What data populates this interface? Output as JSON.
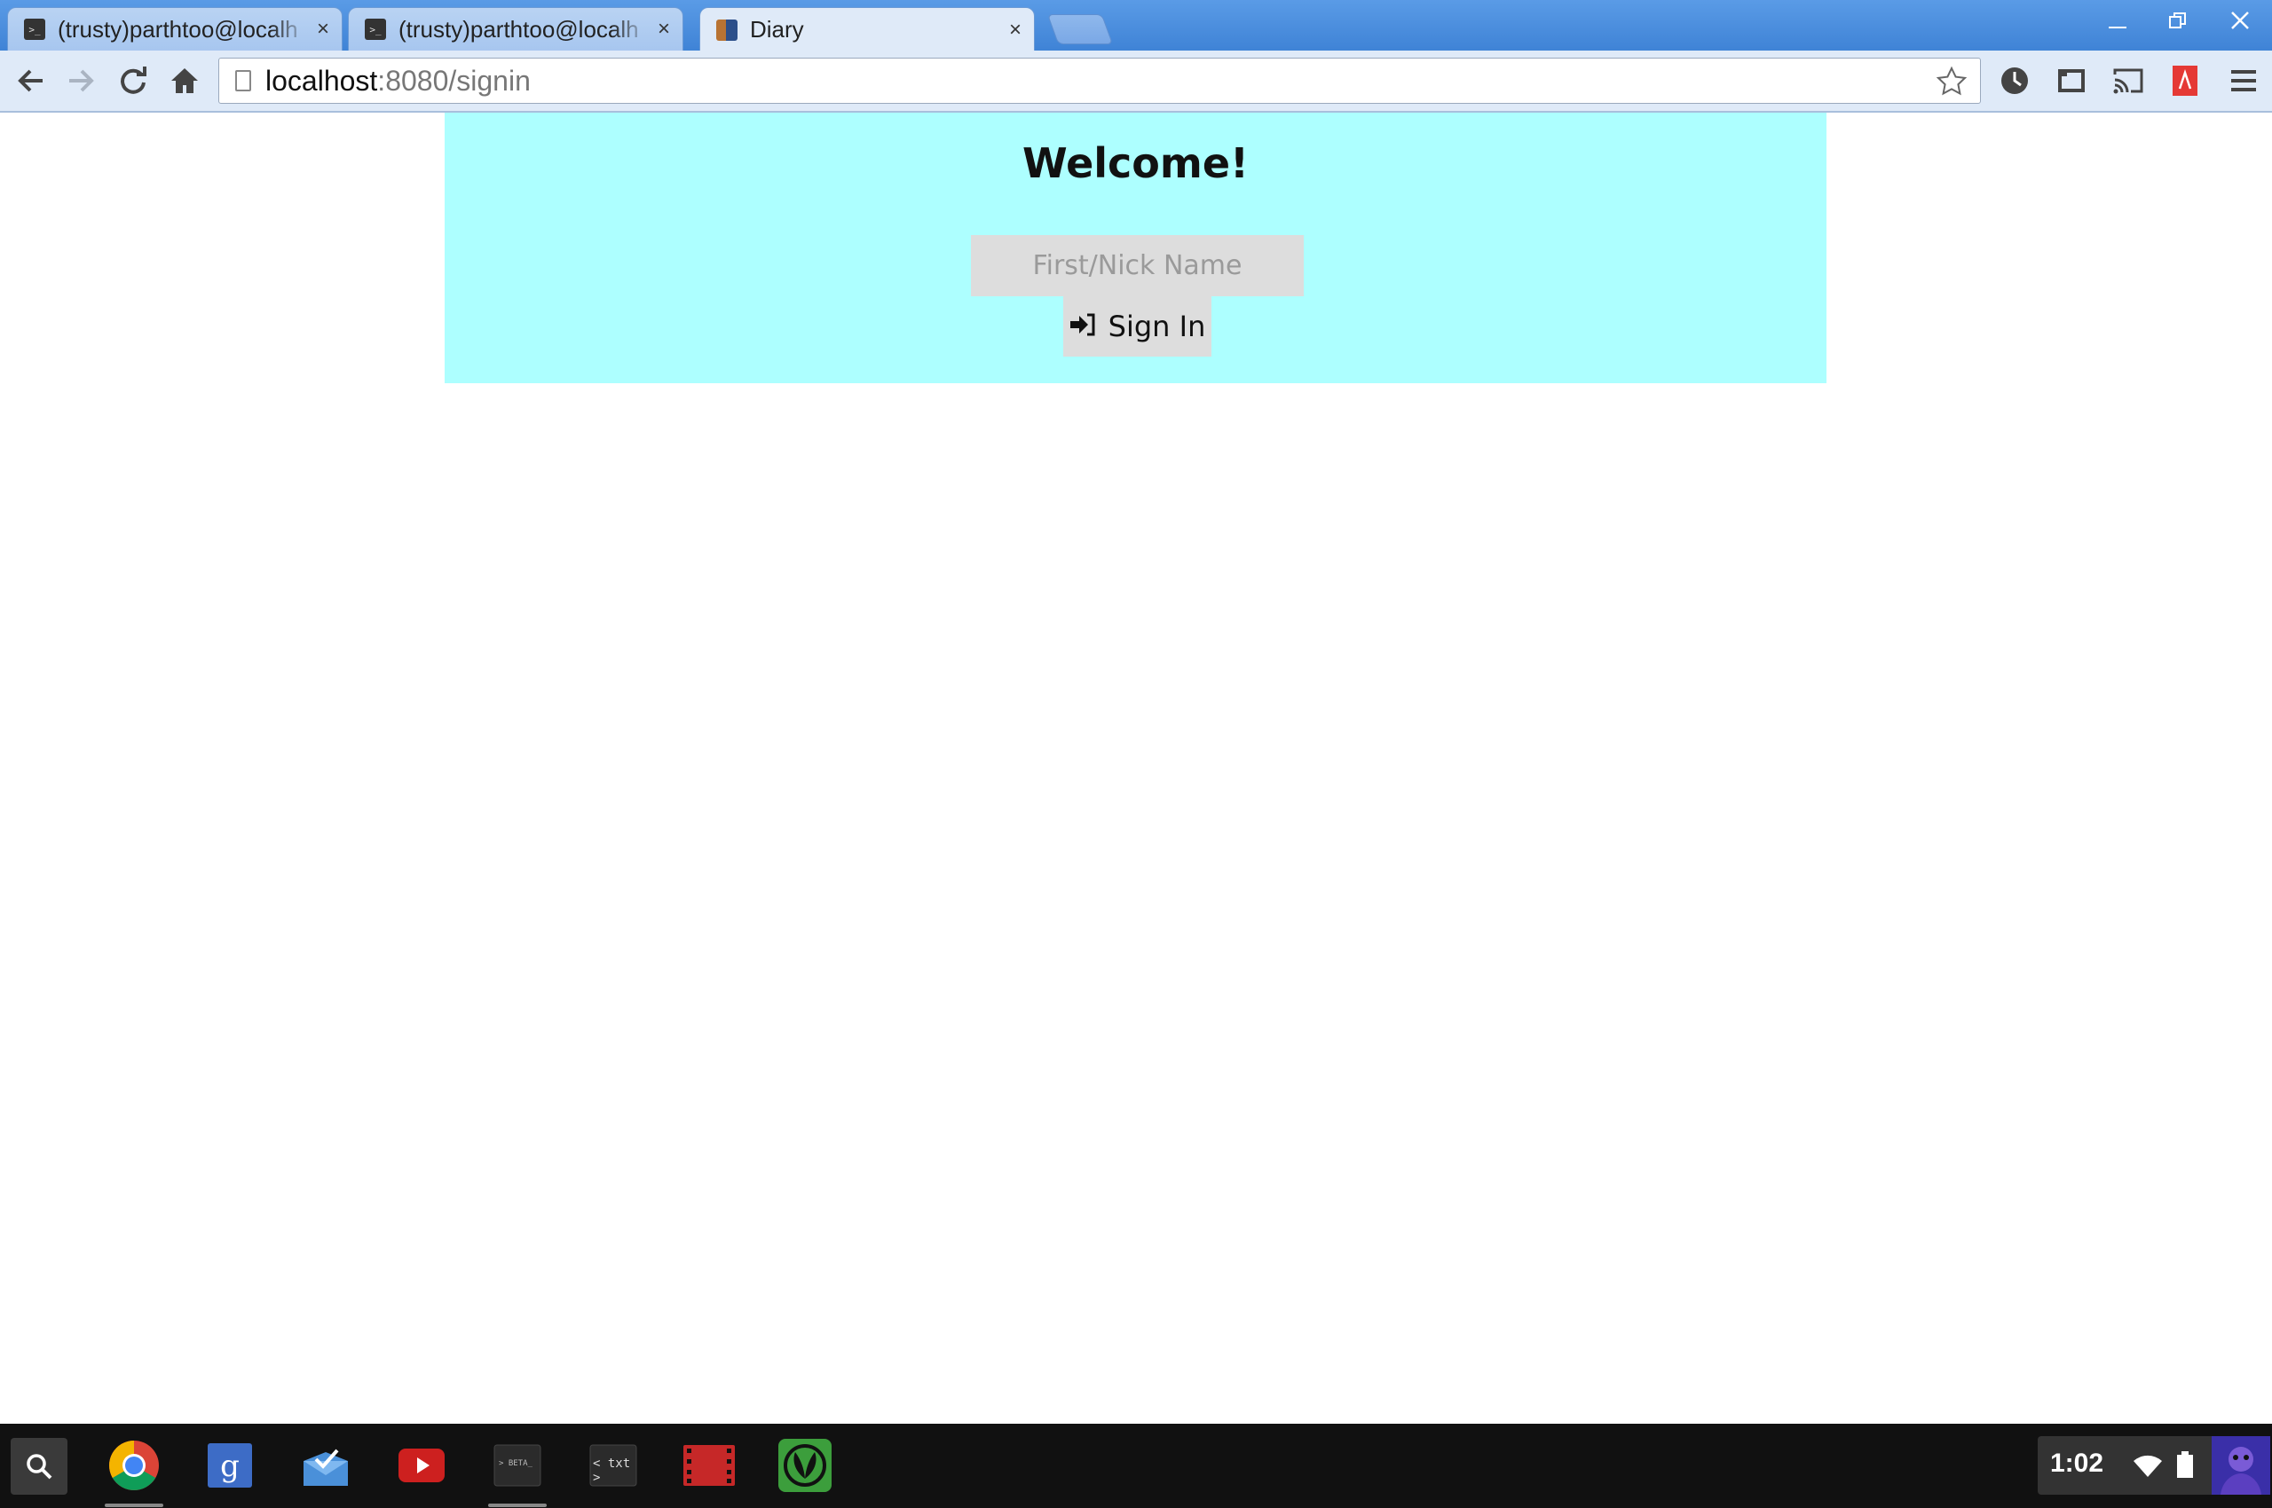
{
  "browser": {
    "tabs": [
      {
        "title": "(trusty)parthtoo@localh",
        "favicon": "terminal-icon",
        "active": false
      },
      {
        "title": "(trusty)parthtoo@localh",
        "favicon": "terminal-icon",
        "active": false
      },
      {
        "title": "Diary",
        "favicon": "diary-icon",
        "active": true
      }
    ],
    "close_glyph": "×",
    "url_host": "localhost",
    "url_path": ":8080/signin"
  },
  "page": {
    "heading": "Welcome!",
    "name_placeholder": "First/Nick Name",
    "name_value": "",
    "signin_label": "Sign In",
    "banner_color": "#adffff",
    "control_color": "#dddddd"
  },
  "shelf": {
    "apps": [
      "search-icon",
      "chrome-icon",
      "google-search-icon",
      "inbox-icon",
      "youtube-icon",
      "terminal-beta-icon",
      "text-editor-icon",
      "video-player-icon",
      "saavn-icon"
    ],
    "terminal_label": "> BETA_",
    "text_app_label": "< txt >",
    "clock": "1:02"
  }
}
